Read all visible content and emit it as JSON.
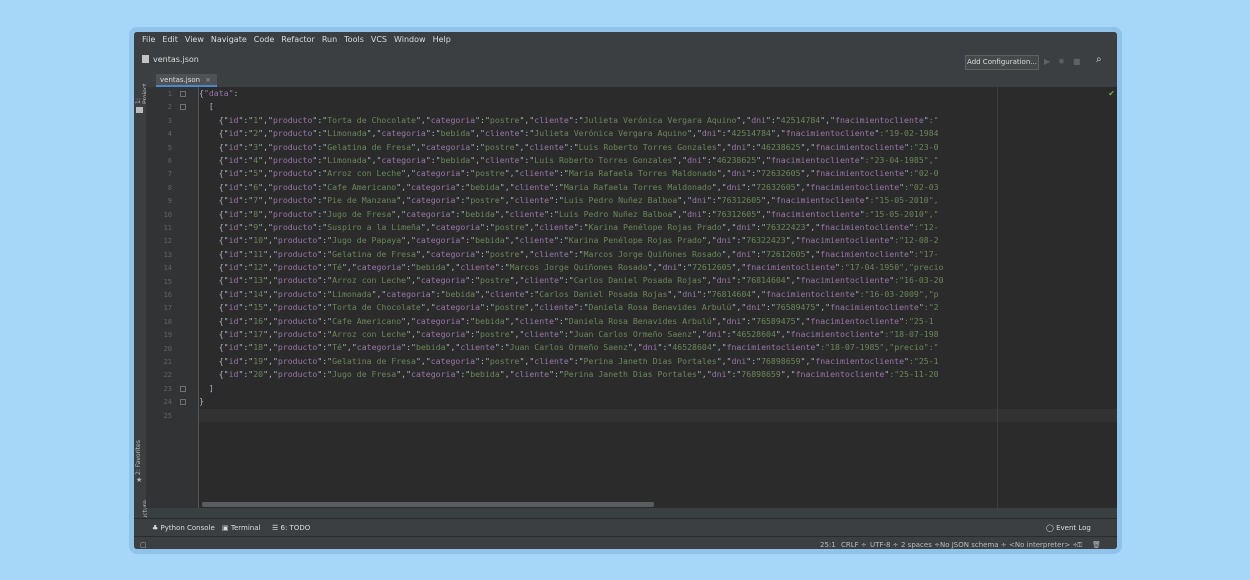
{
  "menu": [
    "File",
    "Edit",
    "View",
    "Navigate",
    "Code",
    "Refactor",
    "Run",
    "Tools",
    "VCS",
    "Window",
    "Help"
  ],
  "breadcrumb": "ventas.json",
  "toolbar": {
    "add_config": "Add Configuration..."
  },
  "tab": {
    "label": "ventas.json"
  },
  "sidebar": {
    "project": "1: Project",
    "favorites": "2: Favorites",
    "structure": "Z: Structure"
  },
  "line_numbers": [
    "1",
    "2",
    "3",
    "4",
    "5",
    "6",
    "7",
    "8",
    "9",
    "10",
    "11",
    "12",
    "13",
    "14",
    "15",
    "16",
    "17",
    "18",
    "19",
    "20",
    "21",
    "22",
    "23",
    "24",
    "25"
  ],
  "records": [
    {
      "id": "1",
      "producto": "Torta de Chocolate",
      "categoria": "postre",
      "cliente": "Julieta Verónica Vergara Aquino",
      "dni": "42514784",
      "fnac": "fnacimientocliente",
      "tail": ":\""
    },
    {
      "id": "2",
      "producto": "Limonada",
      "categoria": "bebida",
      "cliente": "Julieta Verónica Vergara Aquino",
      "dni": "42514784",
      "fnac": "fnacimientocliente",
      "tail": ":\"19-02-1984"
    },
    {
      "id": "3",
      "producto": "Gelatina de Fresa",
      "categoria": "postre",
      "cliente": "Luis Roberto Torres Gonzales",
      "dni": "46238625",
      "fnac": "fnacimientocliente",
      "tail": ":\"23-0"
    },
    {
      "id": "4",
      "producto": "Limonada",
      "categoria": "bebida",
      "cliente": "Luis Roberto Torres Gonzales",
      "dni": "46238625",
      "fnac": "fnacimientocliente",
      "tail": ":\"23-04-1985\",\""
    },
    {
      "id": "5",
      "producto": "Arroz con Leche",
      "categoria": "postre",
      "cliente": "Maria Rafaela Torres Maldonado",
      "dni": "72632605",
      "fnac": "fnacimientocliente",
      "tail": ":\"02-0"
    },
    {
      "id": "6",
      "producto": "Cafe Americano",
      "categoria": "bebida",
      "cliente": "Maria Rafaela Torres Maldonado",
      "dni": "72632605",
      "fnac": "fnacimientocliente",
      "tail": ":\"02-03"
    },
    {
      "id": "7",
      "producto": "Pie de Manzana",
      "categoria": "postre",
      "cliente": "Luis Pedro Nuñez Balboa",
      "dni": "76312605",
      "fnac": "fnacimientocliente",
      "tail": ":\"15-05-2010\","
    },
    {
      "id": "8",
      "producto": "Jugo de Fresa",
      "categoria": "bebida",
      "cliente": "Luis Pedro Nuñez Balboa",
      "dni": "76312605",
      "fnac": "fnacimientocliente",
      "tail": ":\"15-05-2010\",\""
    },
    {
      "id": "9",
      "producto": "Suspiro a la Limeña",
      "categoria": "postre",
      "cliente": "Karina Penélope Rojas Prado",
      "dni": "76322423",
      "fnac": "fnacimientocliente",
      "tail": ":\"12-"
    },
    {
      "id": "10",
      "producto": "Jugo de Papaya",
      "categoria": "bebida",
      "cliente": "Karina Penélope Rojas Prado",
      "dni": "76322423",
      "fnac": "fnacimientocliente",
      "tail": ":\"12-08-2"
    },
    {
      "id": "11",
      "producto": "Gelatina de Fresa",
      "categoria": "postre",
      "cliente": "Marcos Jorge Quiñones Rosado",
      "dni": "72612605",
      "fnac": "fnacimientocliente",
      "tail": ":\"17-"
    },
    {
      "id": "12",
      "producto": "Té",
      "categoria": "bebida",
      "cliente": "Marcos Jorge Quiñones Rosado",
      "dni": "72612605",
      "fnac": "fnacimientocliente",
      "tail": ":\"17-04-1950\",\"precio"
    },
    {
      "id": "13",
      "producto": "Arroz con Leche",
      "categoria": "postre",
      "cliente": "Carlos Daniel Posada Rojas",
      "dni": "76814604",
      "fnac": "fnacimientocliente",
      "tail": ":\"16-03-20"
    },
    {
      "id": "14",
      "producto": "Limonada",
      "categoria": "bebida",
      "cliente": "Carlos Daniel Posada Rojas",
      "dni": "76814604",
      "fnac": "fnacimientocliente",
      "tail": ":\"16-03-2009\",\"p"
    },
    {
      "id": "15",
      "producto": "Torta de Chocolate",
      "categoria": "postre",
      "cliente": "Daniela Rosa Benavides Arbulú",
      "dni": "76589475",
      "fnac": "fnacimientocliente",
      "tail": ":\"2"
    },
    {
      "id": "16",
      "producto": "Cafe Americano",
      "categoria": "bebida",
      "cliente": "Daniela Rosa Benavides Arbulú",
      "dni": "76589475",
      "fnac": "fnacimientocliente",
      "tail": ":\"25-1"
    },
    {
      "id": "17",
      "producto": "Arroz con Leche",
      "categoria": "postre",
      "cliente": "Juan Carlos Ormeño Saenz",
      "dni": "46528604",
      "fnac": "fnacimientocliente",
      "tail": ":\"18-07-198"
    },
    {
      "id": "18",
      "producto": "Té",
      "categoria": "bebida",
      "cliente": "Juan Carlos Ormeño Saenz",
      "dni": "46528604",
      "fnac": "fnacimientocliente",
      "tail": ":\"18-07-1985\",\"precio\":\""
    },
    {
      "id": "19",
      "producto": "Gelatina de Fresa",
      "categoria": "postre",
      "cliente": "Perina Janeth Dias Portales",
      "dni": "76898659",
      "fnac": "fnacimientocliente",
      "tail": ":\"25-1"
    },
    {
      "id": "20",
      "producto": "Jugo de Fresa",
      "categoria": "bebida",
      "cliente": "Perina Janeth Dias Portales",
      "dni": "76898659",
      "fnac": "fnacimientocliente",
      "tail": ":\"25-11-20"
    }
  ],
  "toolwindows": {
    "python_console": "Python Console",
    "terminal": "Terminal",
    "todo": "6: TODO",
    "event_log": "Event Log"
  },
  "status": {
    "position": "25:1",
    "line_sep": "CRLF ÷",
    "encoding": "UTF-8 ÷",
    "indent": "2 spaces ÷",
    "schema": "No JSON schema ÷",
    "interpreter": "<No interpreter> ÷"
  }
}
